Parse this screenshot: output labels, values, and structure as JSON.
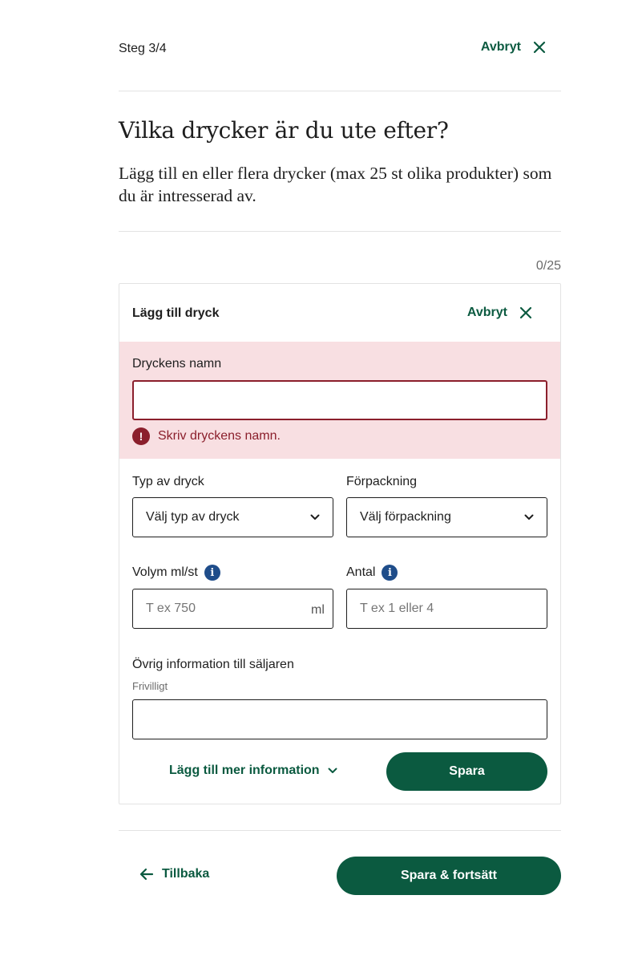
{
  "header": {
    "step": "Steg 3/4",
    "cancel_label": "Avbryt"
  },
  "page": {
    "title": "Vilka drycker är du ute efter?",
    "lead": "Lägg till en eller flera drycker (max 25 st olika produkter) som du är intresserad av.",
    "counter": "0/25"
  },
  "card": {
    "title": "Lägg till dryck",
    "cancel_label": "Avbryt",
    "name_field": {
      "label": "Dryckens namn",
      "value": "",
      "error": "Skriv dryckens namn."
    },
    "type_field": {
      "label": "Typ av dryck",
      "selected": "Välj typ av dryck"
    },
    "package_field": {
      "label": "Förpackning",
      "selected": "Välj förpackning"
    },
    "volume_field": {
      "label": "Volym ml/st",
      "placeholder": "T ex 750",
      "unit": "ml"
    },
    "amount_field": {
      "label": "Antal",
      "placeholder": "T ex 1 eller 4"
    },
    "info_field": {
      "label": "Övrig information till säljaren",
      "sublabel": "Frivilligt",
      "value": ""
    },
    "more_label": "Lägg till mer information",
    "save_label": "Spara"
  },
  "footer": {
    "back_label": "Tillbaka",
    "continue_label": "Spara & fortsätt"
  },
  "colors": {
    "accent": "#0b5a40",
    "error": "#8b1f2c",
    "error_bg": "#f8dfe2",
    "info": "#1f4d8a"
  },
  "icons": {
    "close": "close-icon",
    "chevron": "chevron-down-icon",
    "info": "info-icon",
    "error": "error-icon",
    "back": "arrow-left-icon"
  }
}
